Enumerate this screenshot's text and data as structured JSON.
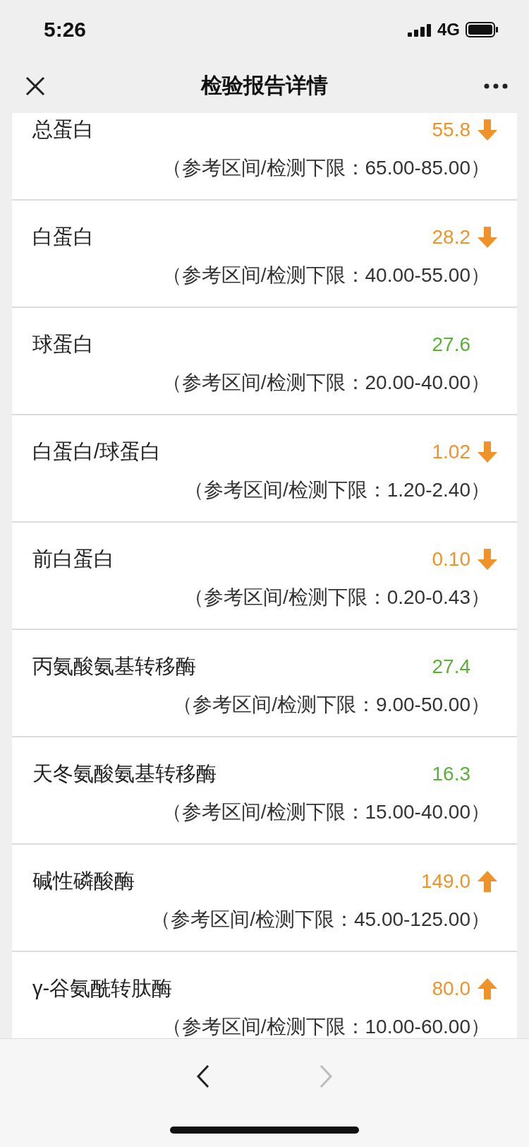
{
  "status_bar": {
    "time": "5:26",
    "network": "4G"
  },
  "nav": {
    "title": "检验报告详情"
  },
  "items": [
    {
      "name": "总蛋白",
      "value": "55.8",
      "low": true,
      "high": false,
      "reference": "（参考区间/检测下限：65.00-85.00）"
    },
    {
      "name": "白蛋白",
      "value": "28.2",
      "low": true,
      "high": false,
      "reference": "（参考区间/检测下限：40.00-55.00）"
    },
    {
      "name": "球蛋白",
      "value": "27.6",
      "low": false,
      "high": false,
      "reference": "（参考区间/检测下限：20.00-40.00）"
    },
    {
      "name": "白蛋白/球蛋白",
      "value": "1.02",
      "low": true,
      "high": false,
      "reference": "（参考区间/检测下限：1.20-2.40）"
    },
    {
      "name": "前白蛋白",
      "value": "0.10",
      "low": true,
      "high": false,
      "reference": "（参考区间/检测下限：0.20-0.43）"
    },
    {
      "name": "丙氨酸氨基转移酶",
      "value": "27.4",
      "low": false,
      "high": false,
      "reference": "（参考区间/检测下限：9.00-50.00）"
    },
    {
      "name": "天冬氨酸氨基转移酶",
      "value": "16.3",
      "low": false,
      "high": false,
      "reference": "（参考区间/检测下限：15.00-40.00）"
    },
    {
      "name": "碱性磷酸酶",
      "value": "149.0",
      "low": false,
      "high": true,
      "reference": "（参考区间/检测下限：45.00-125.00）"
    },
    {
      "name": "γ-谷氨酰转肽酶",
      "value": "80.0",
      "low": false,
      "high": true,
      "reference": "（参考区间/检测下限：10.00-60.00）"
    }
  ],
  "toolbar": {
    "back_disabled": false,
    "forward_disabled": true
  }
}
